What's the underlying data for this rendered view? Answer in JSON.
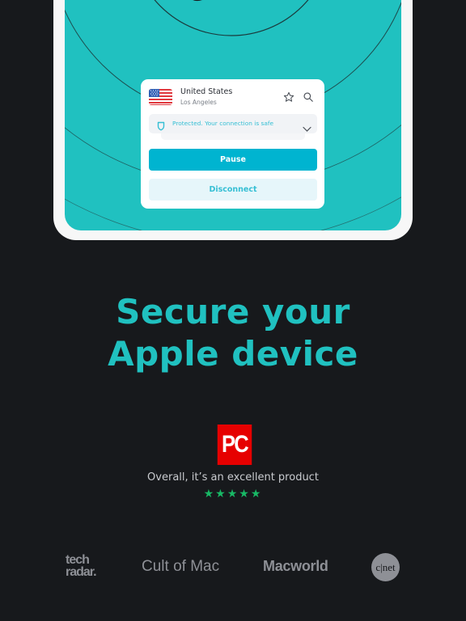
{
  "vpn_card": {
    "country": "United States",
    "city": "Los Angeles",
    "flag_icon": "us-flag-icon",
    "favorite_icon": "star-icon",
    "search_icon": "search-icon",
    "status_text": "Protected. Your connection is safe",
    "status_icon": "shield-icon",
    "expand_icon": "chevron-down-icon",
    "pause_label": "Pause",
    "disconnect_label": "Disconnect"
  },
  "headline": {
    "line1": "Secure your",
    "line2": "Apple device"
  },
  "review": {
    "source_logo": "PC",
    "quote": "Overall, it’s an excellent product",
    "rating": 5,
    "max_rating": 5,
    "stars_text": "★★★★★"
  },
  "press": {
    "techradar_line1": "tech",
    "techradar_line2": "radar.",
    "cultofmac": "Cult of Mac",
    "macworld": "Macworld",
    "cnet": "c|net"
  },
  "colors": {
    "accent_teal": "#20c1c0",
    "button_primary": "#00b4d0",
    "background": "#17191c",
    "pc_red": "#e60000",
    "star_green": "#18b865"
  }
}
